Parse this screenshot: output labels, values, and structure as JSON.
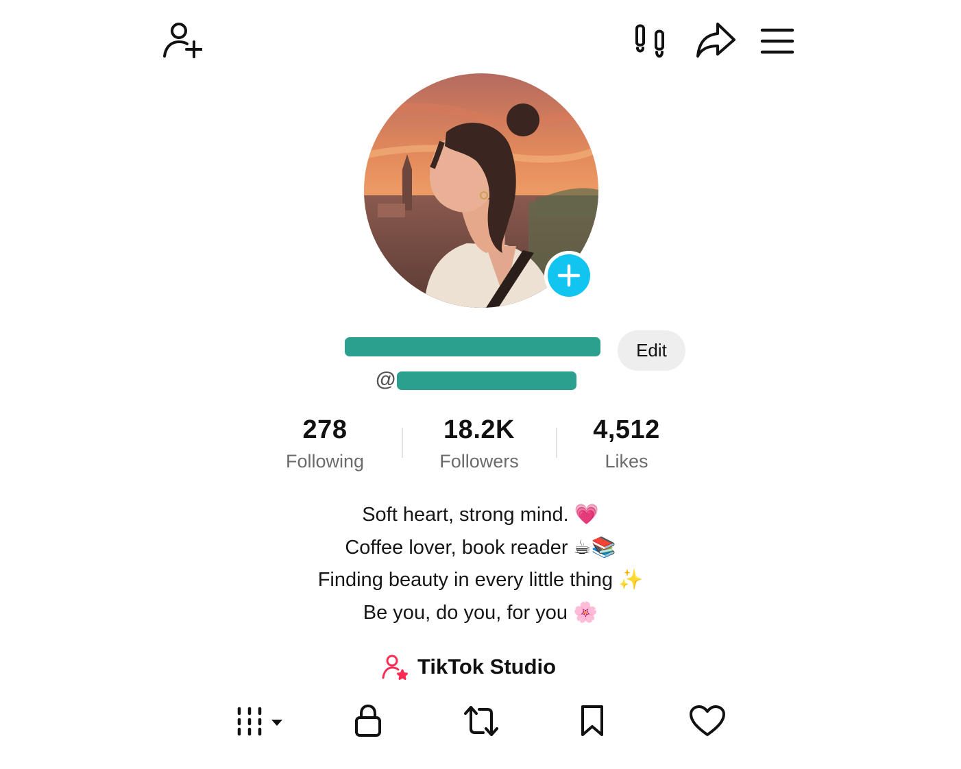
{
  "header": {
    "add_friend_icon": "person-plus-icon",
    "footprints_icon": "footprints-icon",
    "share_icon": "share-arrow-icon",
    "menu_icon": "hamburger-menu-icon"
  },
  "profile": {
    "avatar": "profile-photo",
    "avatar_add_icon": "plus-icon",
    "handle_prefix": "@",
    "edit_label": "Edit",
    "accent_color": "#2ba08f",
    "add_color": "#12c4f0"
  },
  "stats": [
    {
      "value": "278",
      "label": "Following"
    },
    {
      "value": "18.2K",
      "label": "Followers"
    },
    {
      "value": "4,512",
      "label": "Likes"
    }
  ],
  "bio": [
    "Soft heart, strong mind. 💗",
    "Coffee lover, book reader ☕📚",
    "Finding beauty in every little thing ✨",
    "Be you, do you, for you 🌸"
  ],
  "studio": {
    "label": "TikTok Studio",
    "icon": "person-star-icon",
    "color": "#fe2c55"
  },
  "tabs": [
    {
      "name": "videos-grid",
      "icon": "grid-bars-icon",
      "selected": true
    },
    {
      "name": "private",
      "icon": "lock-icon"
    },
    {
      "name": "reposts",
      "icon": "repost-icon"
    },
    {
      "name": "favorites",
      "icon": "bookmark-icon"
    },
    {
      "name": "liked",
      "icon": "heart-icon"
    }
  ]
}
